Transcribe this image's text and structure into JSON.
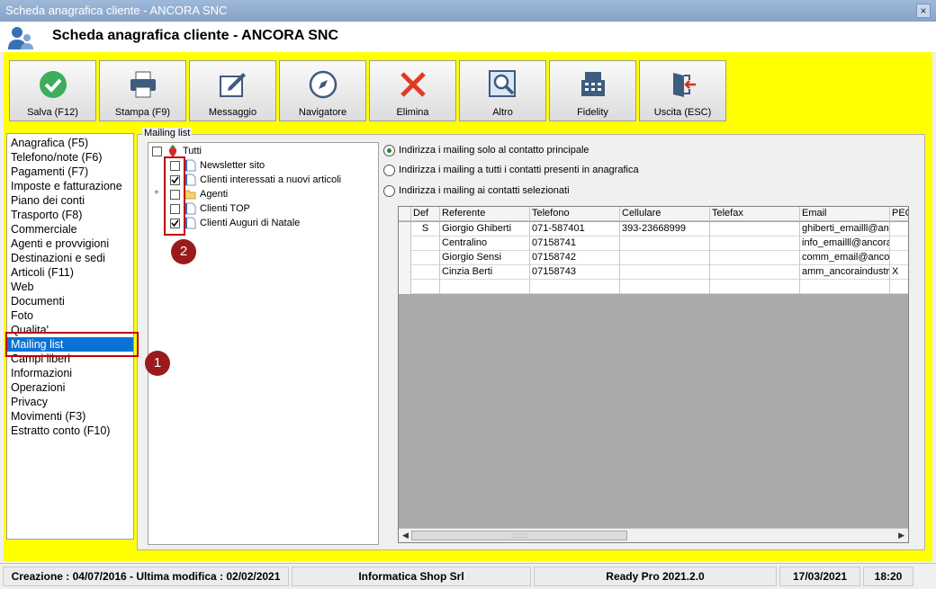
{
  "window": {
    "title": "Scheda anagrafica cliente - ANCORA SNC",
    "close_glyph": "×"
  },
  "header": {
    "title": "Scheda anagrafica cliente - ANCORA SNC"
  },
  "toolbar": {
    "buttons": [
      {
        "label": "Salva (F12)",
        "icon": "check-icon"
      },
      {
        "label": "Stampa (F9)",
        "icon": "printer-icon"
      },
      {
        "label": "Messaggio",
        "icon": "message-icon"
      },
      {
        "label": "Navigatore",
        "icon": "compass-icon"
      },
      {
        "label": "Elimina",
        "icon": "delete-icon"
      },
      {
        "label": "Altro",
        "icon": "magnifier-icon"
      },
      {
        "label": "Fidelity",
        "icon": "cash-register-icon"
      },
      {
        "label": "Uscita (ESC)",
        "icon": "exit-icon"
      }
    ]
  },
  "sidebar": {
    "items": [
      "Anagrafica (F5)",
      "Telefono/note (F6)",
      "Pagamenti (F7)",
      "Imposte e fatturazione",
      "Piano dei conti",
      "Trasporto (F8)",
      "Commerciale",
      "Agenti e provvigioni",
      "Destinazioni e sedi",
      "Articoli (F11)",
      "Web",
      "Documenti",
      "Foto",
      "Qualita'",
      "Mailing list",
      "Campi liberi",
      "Informazioni",
      "Operazioni",
      "Privacy",
      "Movimenti (F3)",
      "Estratto conto (F10)"
    ],
    "selected": "Mailing list"
  },
  "mailing": {
    "group_title": "Mailing list",
    "tree": {
      "root": {
        "label": "Tutti",
        "checked": false
      },
      "items": [
        {
          "label": "Newsletter sito",
          "checked": false,
          "type": "document"
        },
        {
          "label": "Clienti interessati a nuovi articoli",
          "checked": true,
          "type": "document"
        },
        {
          "label": "Agenti",
          "checked": false,
          "type": "folder",
          "expander": "+"
        },
        {
          "label": "Clienti TOP",
          "checked": false,
          "type": "document"
        },
        {
          "label": "Clienti Auguri di Natale",
          "checked": true,
          "type": "document"
        }
      ]
    },
    "options": [
      {
        "label": "Indirizza i mailing solo al contatto principale",
        "selected": true
      },
      {
        "label": "Indirizza i mailing a tutti i contatti presenti in anagrafica",
        "selected": false
      },
      {
        "label": "Indirizza i mailing ai contatti selezionati",
        "selected": false
      }
    ],
    "grid": {
      "columns": [
        "Def",
        "Referente",
        "Telefono",
        "Cellulare",
        "Telefax",
        "Email",
        "PEC"
      ],
      "rows": [
        [
          "S",
          "Giorgio Ghiberti",
          "071-587401",
          "393-23668999",
          "",
          "ghiberti_emailll@an",
          ""
        ],
        [
          "",
          "Centralino",
          "07158741",
          "",
          "",
          "info_emailll@ancora",
          ""
        ],
        [
          "",
          "Giorgio Sensi",
          "07158742",
          "",
          "",
          "comm_email@ancor",
          ""
        ],
        [
          "",
          "Cinzia Berti",
          "07158743",
          "",
          "",
          "amm_ancoraindustr",
          "X"
        ],
        [
          "",
          "",
          "",
          "",
          "",
          "",
          ""
        ]
      ],
      "scroll_grip": "::::::::",
      "scroll_left": "◀",
      "scroll_right": "▶"
    }
  },
  "annotations": {
    "badge1": "1",
    "badge2": "2"
  },
  "status": {
    "dates": "Creazione : 04/07/2016 - Ultima modifica : 02/02/2021",
    "company": "Informatica Shop Srl",
    "version": "Ready Pro 2021.2.0",
    "date": "17/03/2021",
    "time": "18:20"
  },
  "colors": {
    "background_highlight": "#ffff00",
    "selection": "#0a72d6",
    "annotation_red": "#c00000"
  }
}
